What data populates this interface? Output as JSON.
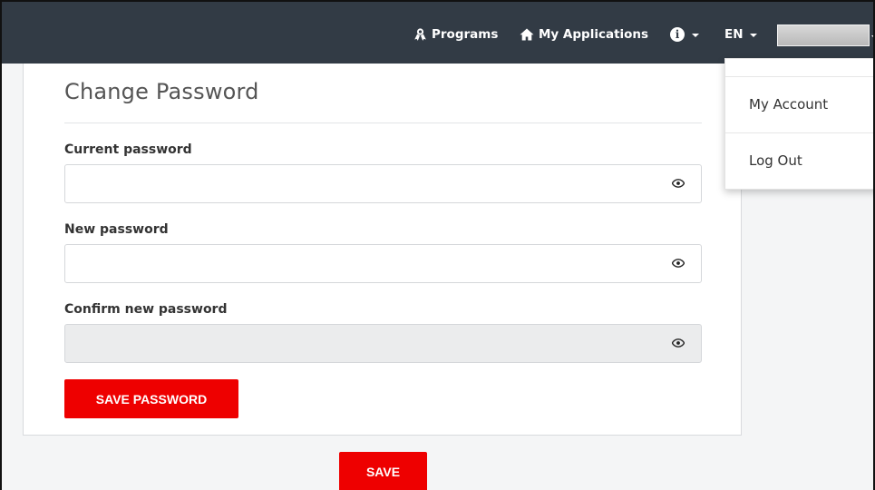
{
  "navbar": {
    "programs_label": "Programs",
    "my_applications_label": "My Applications",
    "info_icon_glyph": "i",
    "language_label": "EN",
    "background_color": "#323b45"
  },
  "user_menu": {
    "items": [
      {
        "label": "My Account"
      },
      {
        "label": "Log Out"
      }
    ]
  },
  "card": {
    "title": "Change Password",
    "fields": [
      {
        "label": "Current password",
        "value": "",
        "disabled": false,
        "icon": "eye-icon"
      },
      {
        "label": "New password",
        "value": "",
        "disabled": false,
        "icon": "eye-icon"
      },
      {
        "label": "Confirm new password",
        "value": "",
        "disabled": true,
        "icon": "eye-icon"
      }
    ],
    "save_password_label": "SAVE PASSWORD"
  },
  "footer": {
    "save_label": "SAVE"
  },
  "colors": {
    "accent_red": "#ee0000",
    "page_background": "#f4f5f6"
  }
}
